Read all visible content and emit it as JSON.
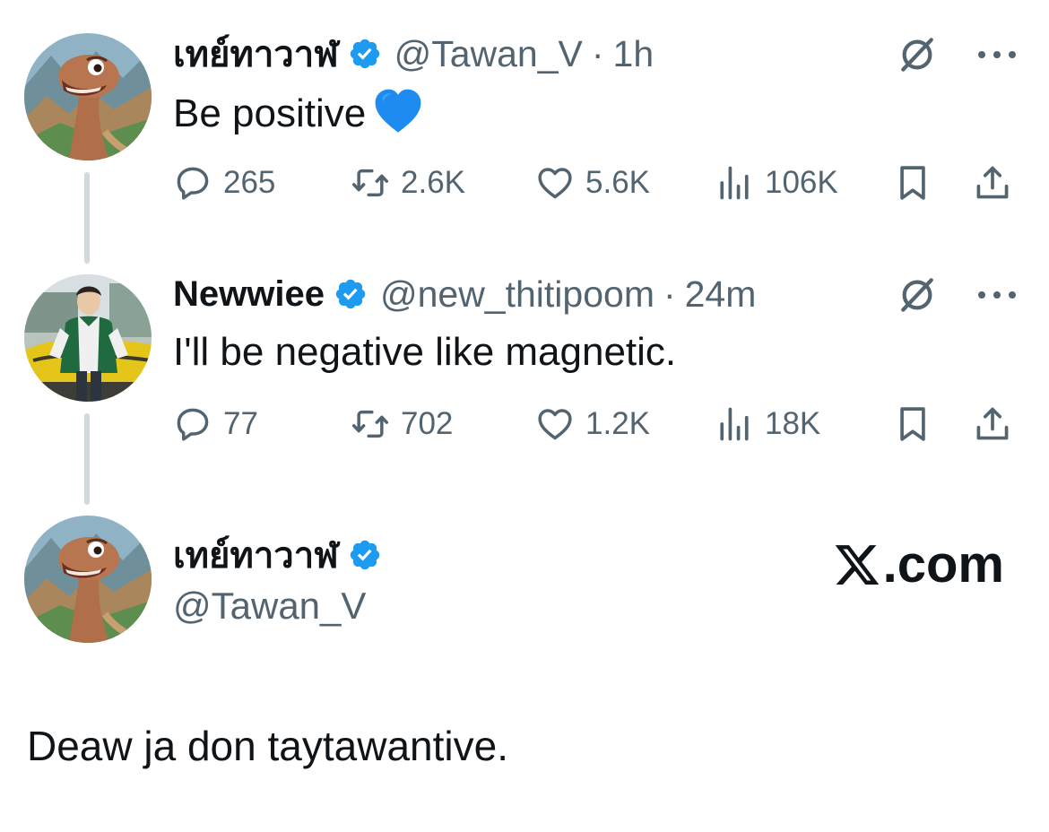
{
  "tweets": [
    {
      "name": "เทย์ทาวาฬ",
      "handle": "@Tawan_V",
      "separator": "·",
      "time": "1h",
      "text": "Be positive",
      "emoji": "blue-heart",
      "replies": "265",
      "reposts": "2.6K",
      "likes": "5.6K",
      "views": "106K"
    },
    {
      "name": "Newwiee",
      "handle": "@new_thitipoom",
      "separator": "·",
      "time": "24m",
      "text": "I'll be negative like magnetic.",
      "replies": "77",
      "reposts": "702",
      "likes": "1.2K",
      "views": "18K"
    }
  ],
  "card": {
    "name": "เทย์ทาวาฬ",
    "handle": "@Tawan_V",
    "brand": ".com",
    "brand_logo": "x-logo"
  },
  "caption": "Deaw ja don taytawantive.",
  "colors": {
    "verified": "#1d9bf0",
    "text": "#0f1419",
    "muted": "#536471",
    "thread_line": "#cfd9de",
    "heart": "#1d8bf0"
  },
  "icons": [
    "reply-icon",
    "repost-icon",
    "like-icon",
    "views-icon",
    "bookmark-icon",
    "share-icon",
    "grok-icon",
    "more-icon",
    "verified-badge-icon"
  ]
}
